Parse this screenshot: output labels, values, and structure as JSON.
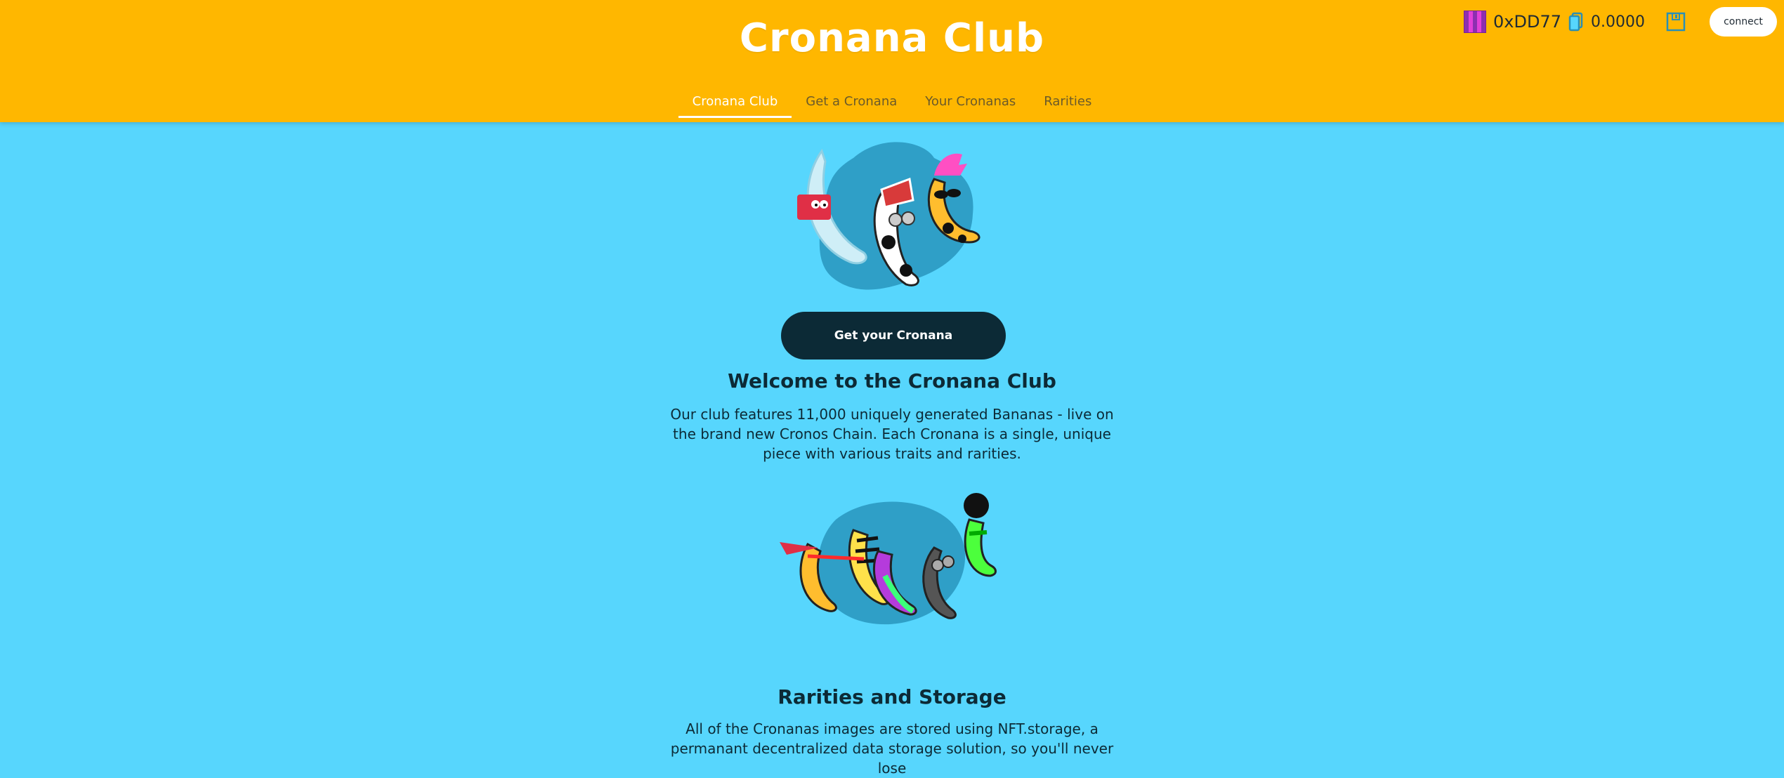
{
  "header": {
    "title": "Cronana Club",
    "nav": [
      {
        "label": "Cronana Club",
        "active": true
      },
      {
        "label": "Get a Cronana",
        "active": false
      },
      {
        "label": "Your Cronanas",
        "active": false
      },
      {
        "label": "Rarities",
        "active": false
      }
    ],
    "wallet": {
      "address": "0xDD77",
      "balance": "0.0000",
      "connect_label": "connect",
      "icons": [
        "identicon-avatar",
        "coin-icon",
        "save-icon"
      ]
    }
  },
  "hero": {
    "image_icon": "bananas-group-illustration",
    "cta_label": "Get your Cronana"
  },
  "welcome": {
    "title": "Welcome to the Cronana Club",
    "text": "Our club features 11,000 uniquely generated Bananas - live on the brand new Cronos Chain. Each Cronana is a single, unique piece with various traits and rarities."
  },
  "gallery": {
    "image_icon": "bananas-lineup-illustration"
  },
  "rarities": {
    "title": "Rarities and Storage",
    "text": "All of the Cronanas images are stored using NFT.storage, a permanant decentralized data storage solution, so you'll never lose"
  },
  "colors": {
    "header_bg": "#ffb700",
    "page_bg": "#57d6fd",
    "dark": "#0c2a36",
    "accent_white": "#ffffff"
  }
}
